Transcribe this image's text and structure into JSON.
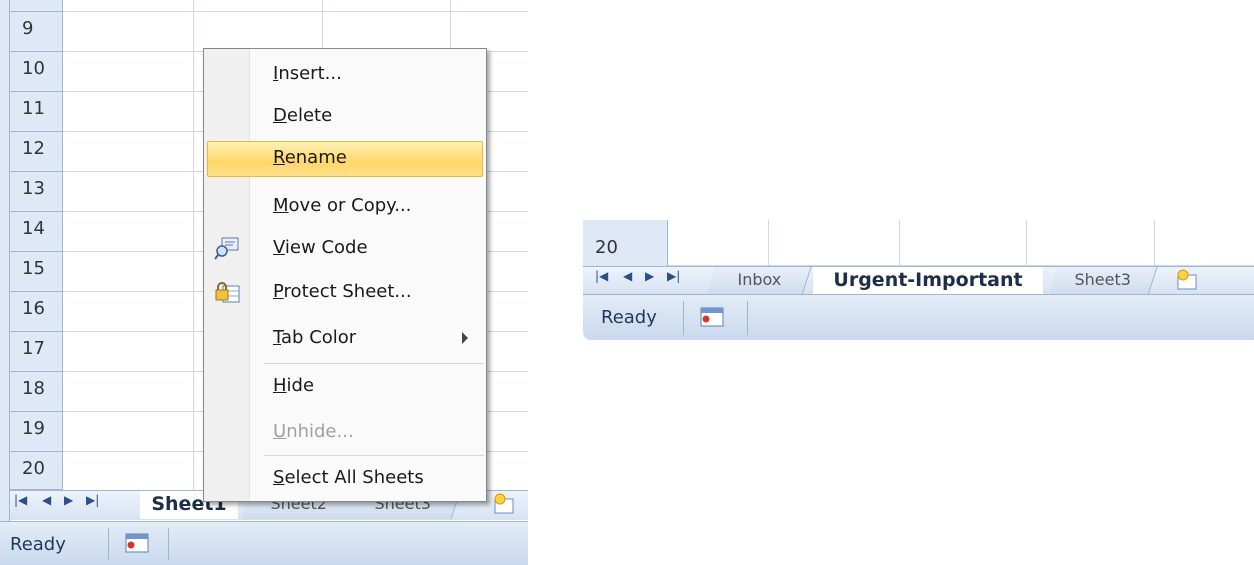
{
  "left": {
    "row_numbers": [
      "9",
      "10",
      "11",
      "12",
      "13",
      "14",
      "15",
      "16",
      "17",
      "18",
      "19",
      "20"
    ],
    "sheet_tabs": [
      "Sheet1",
      "Sheet2",
      "Sheet3"
    ],
    "status": "Ready"
  },
  "context_menu": {
    "items": [
      {
        "pre": "",
        "ul": "I",
        "post": "nsert..."
      },
      {
        "pre": "",
        "ul": "D",
        "post": "elete"
      },
      {
        "pre": "",
        "ul": "R",
        "post": "ename"
      },
      {
        "pre": "",
        "ul": "M",
        "post": "ove or Copy..."
      },
      {
        "pre": "",
        "ul": "V",
        "post": "iew Code"
      },
      {
        "pre": "",
        "ul": "P",
        "post": "rotect Sheet..."
      },
      {
        "pre": "",
        "ul": "T",
        "post": "ab Color"
      },
      {
        "pre": "",
        "ul": "H",
        "post": "ide"
      },
      {
        "pre": "",
        "ul": "U",
        "post": "nhide..."
      },
      {
        "pre": "",
        "ul": "S",
        "post": "elect All Sheets"
      }
    ]
  },
  "right": {
    "row_number": "20",
    "sheet_tabs": [
      "Inbox",
      "Urgent-Important",
      "Sheet3"
    ],
    "status": "Ready"
  },
  "colors": {
    "highlight": "#ffd66b",
    "header_bg": "#dfe8f6",
    "status_bg": "#c9d9ee",
    "accent": "#1e395b"
  },
  "icons": [
    "first-sheet-icon",
    "prev-sheet-icon",
    "next-sheet-icon",
    "last-sheet-icon",
    "insert-sheet-icon",
    "macro-record-icon",
    "view-code-icon",
    "protect-sheet-icon",
    "submenu-arrow-icon"
  ]
}
